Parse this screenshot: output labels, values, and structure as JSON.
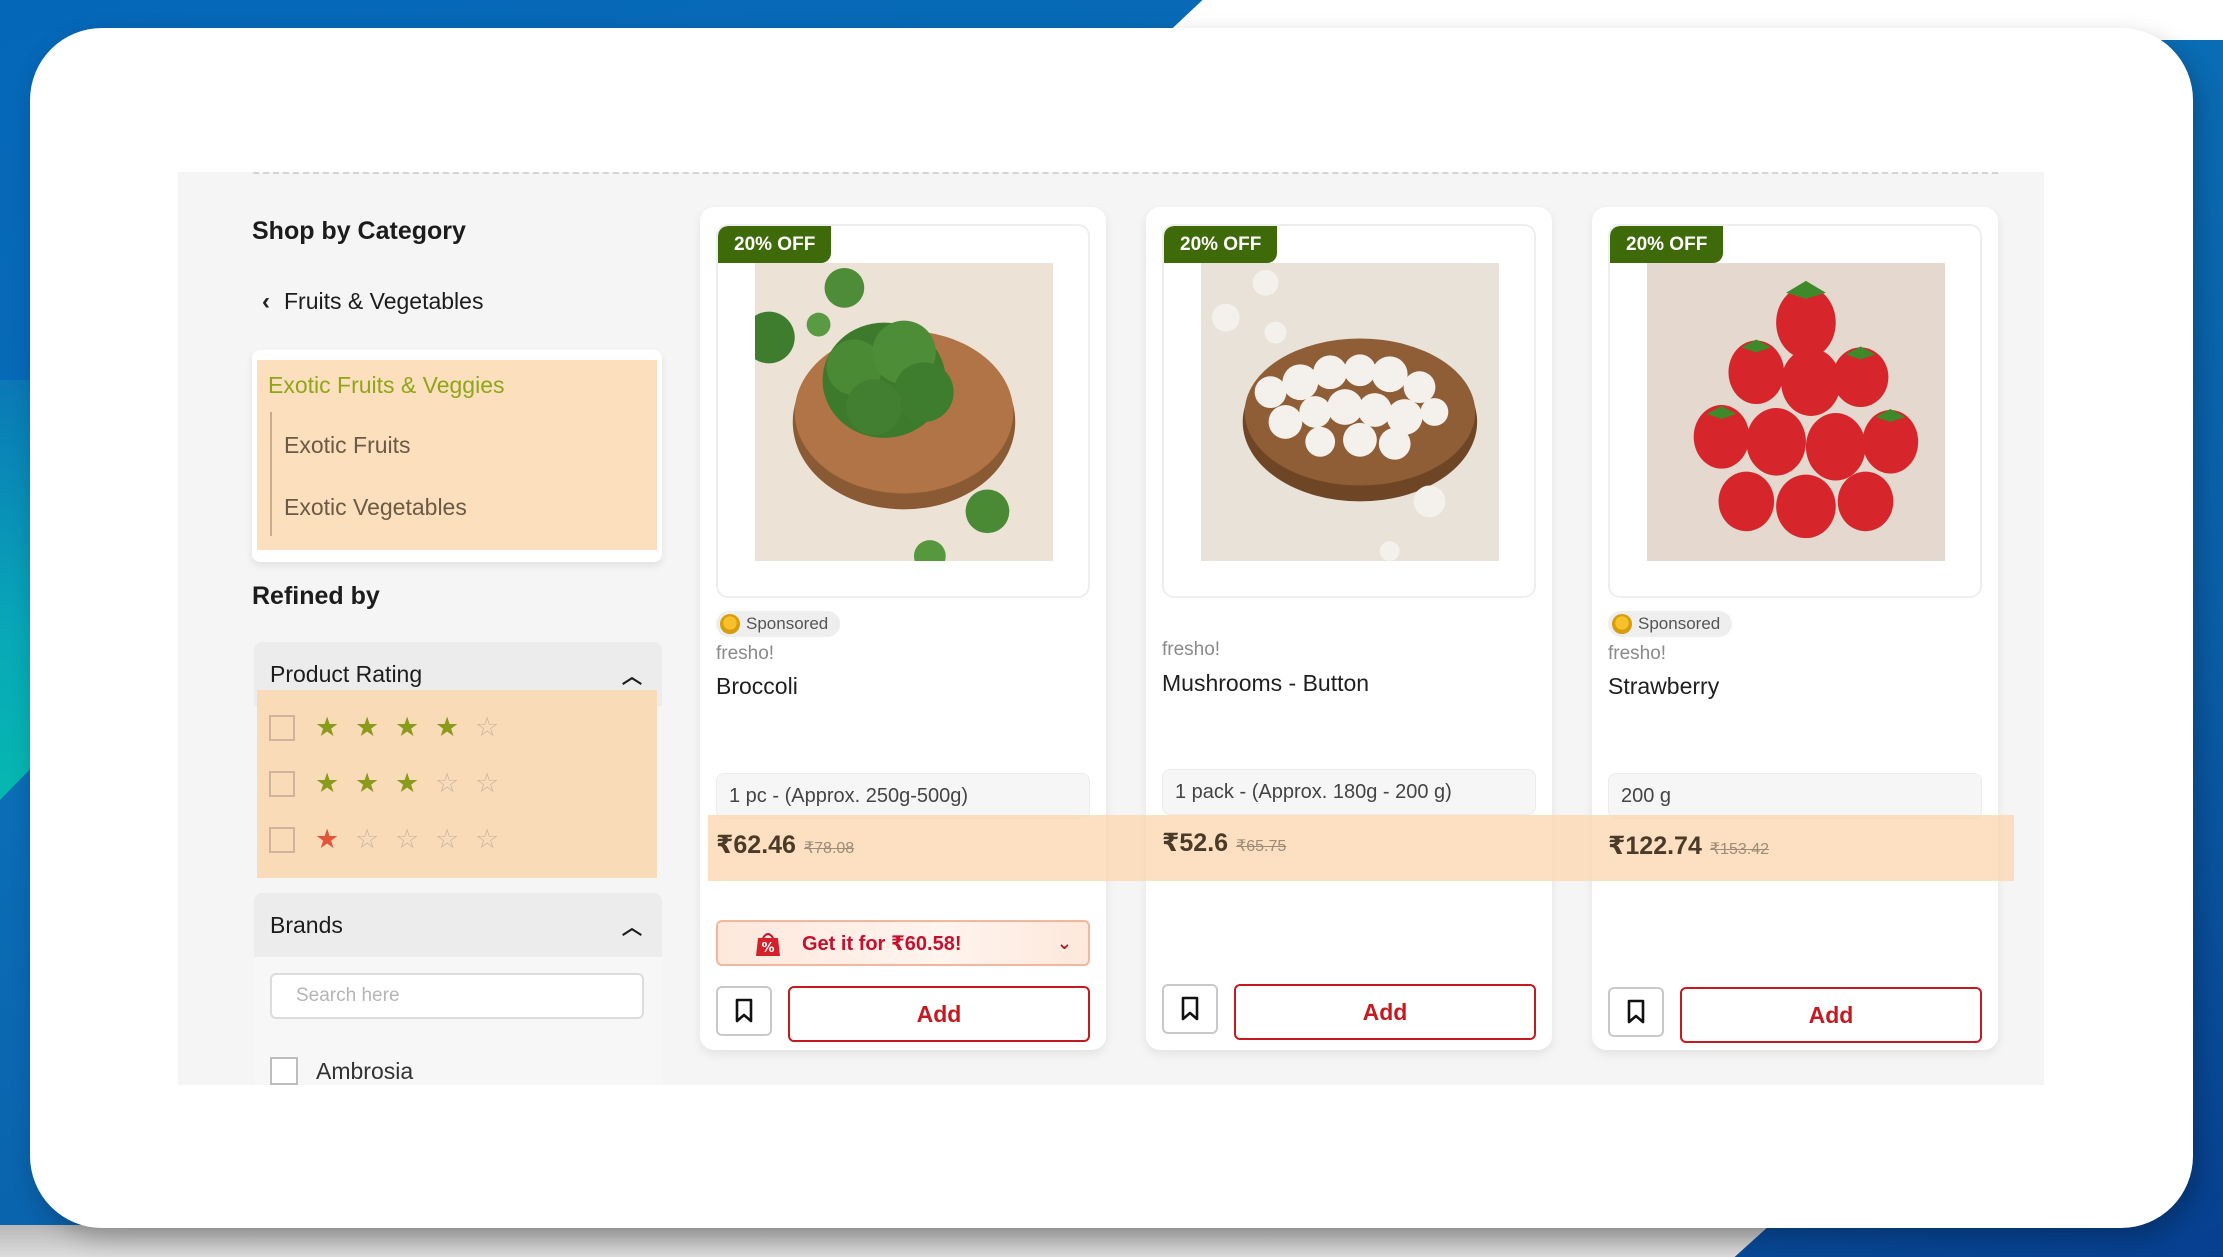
{
  "sidebar": {
    "title": "Shop by Category",
    "back_label": "Fruits & Vegetables",
    "category": {
      "active": "Exotic Fruits & Veggies",
      "subcategories": [
        "Exotic Fruits",
        "Exotic Vegetables"
      ]
    },
    "refined_by": "Refined by",
    "rating_filter": {
      "title": "Product Rating",
      "options": [
        {
          "stars": 4,
          "checked": false
        },
        {
          "stars": 3,
          "checked": false
        },
        {
          "stars": 1,
          "checked": false
        }
      ]
    },
    "brand_filter": {
      "title": "Brands",
      "search_placeholder": "Search here",
      "search_value": "",
      "options": [
        {
          "label": "Ambrosia",
          "checked": false
        }
      ]
    }
  },
  "products": [
    {
      "discount_badge": "20% OFF",
      "image": "broccoli",
      "sponsored": "Sponsored",
      "brand": "fresho!",
      "name": "Broccoli",
      "pack": "1 pc - (Approx. 250g-500g)",
      "price": "₹62.46",
      "mrp": "₹78.08",
      "offer": "Get it for ₹60.58!",
      "add_label": "Add"
    },
    {
      "discount_badge": "20% OFF",
      "image": "mushrooms",
      "sponsored": null,
      "brand": "fresho!",
      "name": "Mushrooms - Button",
      "pack": "1 pack - (Approx. 180g - 200 g)",
      "price": "₹52.6",
      "mrp": "₹65.75",
      "offer": null,
      "add_label": "Add"
    },
    {
      "discount_badge": "20% OFF",
      "image": "strawberry",
      "sponsored": "Sponsored",
      "brand": "fresho!",
      "name": "Strawberry",
      "pack": "200 g",
      "price": "₹122.74",
      "mrp": "₹153.42",
      "offer": null,
      "add_label": "Add"
    }
  ],
  "colors": {
    "accent_red": "#c41a20",
    "badge_green": "#3f6a0a",
    "category_active": "#8fa61b",
    "highlight": "#fcdfbc",
    "star_green": "#8a9a1a",
    "star_red": "#e2563a"
  }
}
